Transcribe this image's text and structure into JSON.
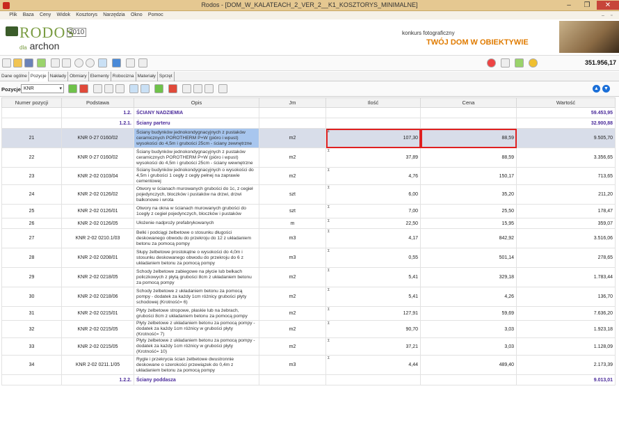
{
  "window": {
    "title": "Rodos - [DOM_W_KALATEACH_2_VER_2__K1_KOSZTORYS_MINIMALNE]",
    "min": "–",
    "max": "❐",
    "close": "✕"
  },
  "menu": [
    "Plik",
    "Baza",
    "Ceny",
    "Widok",
    "Kosztorys",
    "Narzędzia",
    "Okno",
    "Pomoc"
  ],
  "logo": {
    "name": "RODOS",
    "year": "2010",
    "dla": "dla",
    "brand": "archon"
  },
  "promo": {
    "line1": "konkurs fotograficzny",
    "line2": "TWÓJ DOM W OBIEKTYWIE"
  },
  "total": "351.956,17",
  "tabs": [
    "Dane ogólne",
    "Pozycje",
    "Nakłady",
    "Obmiary",
    "Elementy",
    "Robocizna",
    "Materiały",
    "Sprzęt"
  ],
  "toolbar2": {
    "label": "Pozycje",
    "select": "KNR"
  },
  "columns": [
    "Numer pozycji",
    "Podstawa",
    "Opis",
    "Jm",
    "Ilość",
    "Cena",
    "Wartość"
  ],
  "rows": [
    {
      "kind": "sec",
      "pod": "1.2.",
      "opis": "ŚCIANY NADZIEMIA",
      "wart": "59.453,95"
    },
    {
      "kind": "sec",
      "pod": "1.2.1.",
      "opis": "Ściany parteru",
      "wart": "32.900,88"
    },
    {
      "kind": "data",
      "nr": "21",
      "pod": "KNR 0-27 0160/02",
      "opis": "Ściany budynków jednokondygnacyjnych z pustaków ceramicznych POROTHERM P+W (pióro i wpust) wysokości do 4,5m i grubości 25cm - ściany zewnętrzne",
      "jm": "m2",
      "il": "107,30",
      "cena": "88,59",
      "wart": "9.505,70",
      "sel": true
    },
    {
      "kind": "data",
      "nr": "22",
      "pod": "KNR 0-27 0160/02",
      "opis": "Ściany budynków jednokondygnacyjnych z pustaków ceramicznych POROTHERM P+W (pióro i wpust) wysokości do 4,5m i grubości 25cm - ściany wewnętrzne",
      "jm": "m2",
      "il": "37,89",
      "cena": "88,59",
      "wart": "3.356,65"
    },
    {
      "kind": "data",
      "nr": "23",
      "pod": "KNR 2-02 0103/04",
      "opis": "Ściany budynków jednokondygnacyjnych o wysokości do 4,5m i grubości 1 cegły z cegły pełnej  na zaprawie cementowej",
      "jm": "m2",
      "il": "4,76",
      "cena": "150,17",
      "wart": "713,65",
      "s": 3
    },
    {
      "kind": "data",
      "nr": "24",
      "pod": "KNR 2-02 0126/02",
      "opis": "Otwory w ścianach murowanych grubości do 1c, z cegieł pojedynczych, bloczków i pustaków na drzwi, drzwi balkonowe i wrota",
      "jm": "szt",
      "il": "6,00",
      "cena": "35,20",
      "wart": "211,20"
    },
    {
      "kind": "data",
      "nr": "25",
      "pod": "KNR 2-02 0126/01",
      "opis": "Otwory na okna w ścianach murowanych grubości do 1cegły z cegieł pojedynczych, bloczków i pustaków",
      "jm": "szt",
      "il": "7,00",
      "cena": "25,50",
      "wart": "178,47",
      "s": 3
    },
    {
      "kind": "data",
      "nr": "26",
      "pod": "KNR 2-02 0126/05",
      "opis": "Ułożenie nadproży prefabrykowanych",
      "jm": "m",
      "il": "22,50",
      "cena": "15,95",
      "wart": "359,07",
      "s": 2
    },
    {
      "kind": "data",
      "nr": "27",
      "pod": "KNR 2-02 0210.1/03",
      "opis": "Belki i podciągi żelbetowe o stosunku długości deskowanego obwodu do przekroju do 12 z układaniem betonu za pomocą pompy",
      "jm": "m3",
      "il": "4,17",
      "cena": "842,92",
      "wart": "3.516,06"
    },
    {
      "kind": "data",
      "nr": "28",
      "pod": "KNR 2-02 0208/01",
      "opis": "Słupy żelbetowe prostokątne o wysokości do 4,0m i stosunku deskowanego obwodu do przekroju do 6 z układaniem betonu za pomocą pompy",
      "jm": "m3",
      "il": "0,55",
      "cena": "501,14",
      "wart": "278,65"
    },
    {
      "kind": "data",
      "nr": "29",
      "pod": "KNR 2-02 0218/05",
      "opis": "Schody żelbetowe zabiegowe na płycie lub belkach policzkowych z płytą grubości 8cm z układaniem betonu za pomocą pompy",
      "jm": "m2",
      "il": "5,41",
      "cena": "329,18",
      "wart": "1.783,44"
    },
    {
      "kind": "data",
      "nr": "30",
      "pod": "KNR 2-02 0218/06",
      "opis": "Schody żelbetowe z układaniem betonu za pomocą pompy - dodatek za każdy 1cm różnicy grubości płyty schodowej (Krotność= 6)",
      "jm": "m2",
      "il": "5,41",
      "cena": "4,26",
      "wart": "136,70"
    },
    {
      "kind": "data",
      "nr": "31",
      "pod": "KNR 2-02 0215/01",
      "opis": "Płyty żelbetowe stropowe, płaskie lub na żebrach, grubości 8cm z układaniem betonu za pomocą pompy",
      "jm": "m2",
      "il": "127,91",
      "cena": "59,69",
      "wart": "7.636,20",
      "s": 3
    },
    {
      "kind": "data",
      "nr": "32",
      "pod": "KNR 2-02 0215/05",
      "opis": "Płyty żelbetowe z układaniem betonu za pomocą pompy - dodatek za każdy 1cm różnicy w grubości płyty (Krotność= 7)",
      "jm": "m2",
      "il": "90,70",
      "cena": "3,03",
      "wart": "1.923,18",
      "s": 3
    },
    {
      "kind": "data",
      "nr": "33",
      "pod": "KNR 2-02 0215/05",
      "opis": "Płyty żelbetowe z układaniem betonu za pomocą pompy - dodatek za każdy 1cm różnicy w grubości płyty (Krotność= 10)",
      "jm": "m2",
      "il": "37,21",
      "cena": "3,03",
      "wart": "1.128,09",
      "s": 3
    },
    {
      "kind": "data",
      "nr": "34",
      "pod": "KNR 2-02 0211.1/05",
      "opis": "Rygle i przekrycia ścian żelbetowe dwustronnie deskowane o szerokości przewiązek do 0,4m z układaniem betonu za pomocą pompy",
      "jm": "m3",
      "il": "4,44",
      "cena": "489,40",
      "wart": "2.173,39"
    },
    {
      "kind": "sec",
      "pod": "1.2.2.",
      "opis": "Ściany poddasza",
      "wart": "9.013,01"
    }
  ]
}
